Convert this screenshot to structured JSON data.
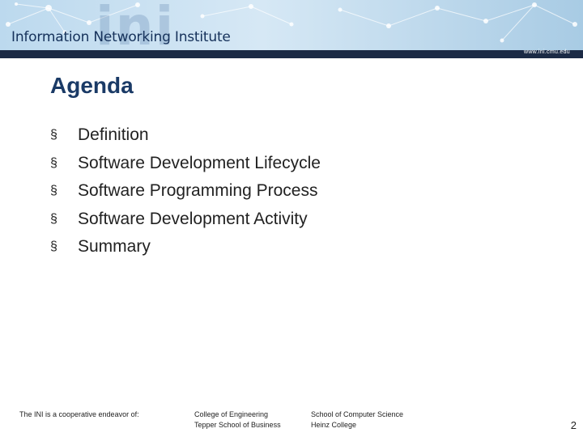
{
  "header": {
    "org_name": "Information Networking Institute",
    "logo_text": "ini",
    "url": "www.ini.cmu.edu"
  },
  "slide": {
    "title": "Agenda",
    "bullet_symbol": "§",
    "items": [
      "Definition",
      "Software Development Lifecycle",
      "Software Programming Process",
      "Software Development Activity",
      "Summary"
    ]
  },
  "footer": {
    "cooperative": "The INI is a cooperative endeavor of:",
    "college_1": "College of Engineering",
    "college_2": "Tepper School of Business",
    "college_3": "School of Computer Science",
    "college_4": "Heinz College",
    "page_number": "2"
  },
  "colors": {
    "banner": "#bcd9ee",
    "navy_strip": "#1b2a45",
    "title": "#1a3a66"
  }
}
